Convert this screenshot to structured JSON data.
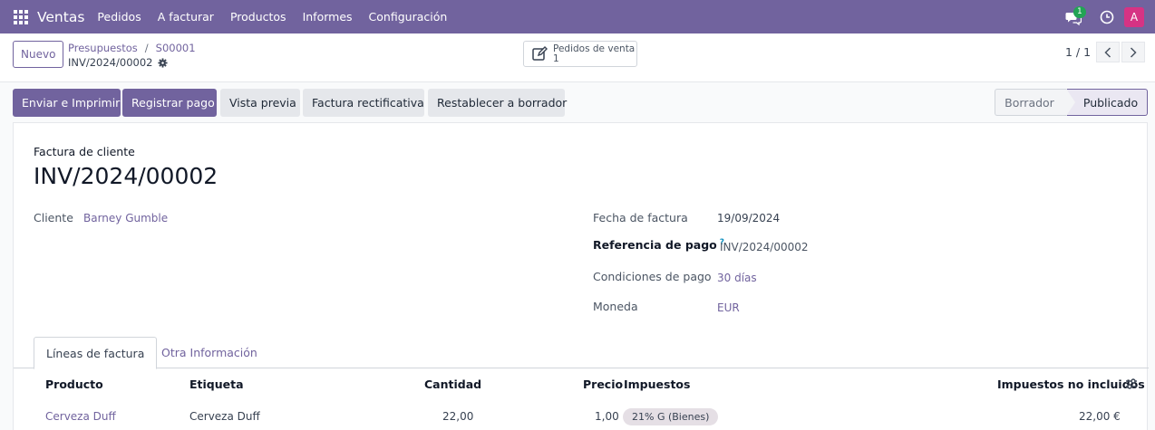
{
  "navbar": {
    "app_name": "Ventas",
    "menu": [
      "Pedidos",
      "A facturar",
      "Productos",
      "Informes",
      "Configuración"
    ],
    "chat_badge": "1",
    "avatar_letter": "A"
  },
  "control": {
    "new_button": "Nuevo",
    "breadcrumb": [
      "Presupuestos",
      "S00001"
    ],
    "breadcrumb_sep": "/",
    "record_name": "INV/2024/00002",
    "smart_button": {
      "label": "Pedidos de venta",
      "count": "1"
    },
    "pager": "1 / 1"
  },
  "actions": {
    "send_print": "Enviar e Imprimir",
    "register_payment": "Registrar pago",
    "preview": "Vista previa",
    "credit_note": "Factura rectificativa",
    "reset_draft": "Restablecer a borrador"
  },
  "stages": {
    "draft": "Borrador",
    "posted": "Publicado"
  },
  "form": {
    "doc_type": "Factura de cliente",
    "doc_name": "INV/2024/00002",
    "customer_label": "Cliente",
    "customer_value": "Barney Gumble",
    "invoice_date_label": "Fecha de factura",
    "invoice_date_value": "19/09/2024",
    "payment_ref_label": "Referencia de pago",
    "payment_ref_help": "?",
    "payment_ref_value": "INV/2024/00002",
    "payment_terms_label": "Condiciones de pago",
    "payment_terms_value": "30 días",
    "currency_label": "Moneda",
    "currency_value": "EUR"
  },
  "tabs": [
    "Líneas de factura",
    "Otra Información"
  ],
  "table": {
    "headers": {
      "product": "Producto",
      "label": "Etiqueta",
      "quantity": "Cantidad",
      "price": "Precio",
      "taxes": "Impuestos",
      "subtotal": "Impuestos no incluidos"
    },
    "rows": [
      {
        "product": "Cerveza Duff",
        "label": "Cerveza Duff",
        "quantity": "22,00",
        "price": "1,00",
        "tax": "21% G (Bienes)",
        "subtotal": "22,00 €"
      }
    ]
  },
  "colors": {
    "brand": "#71639e",
    "badge": "#22a454",
    "avatar": "#d63384"
  }
}
